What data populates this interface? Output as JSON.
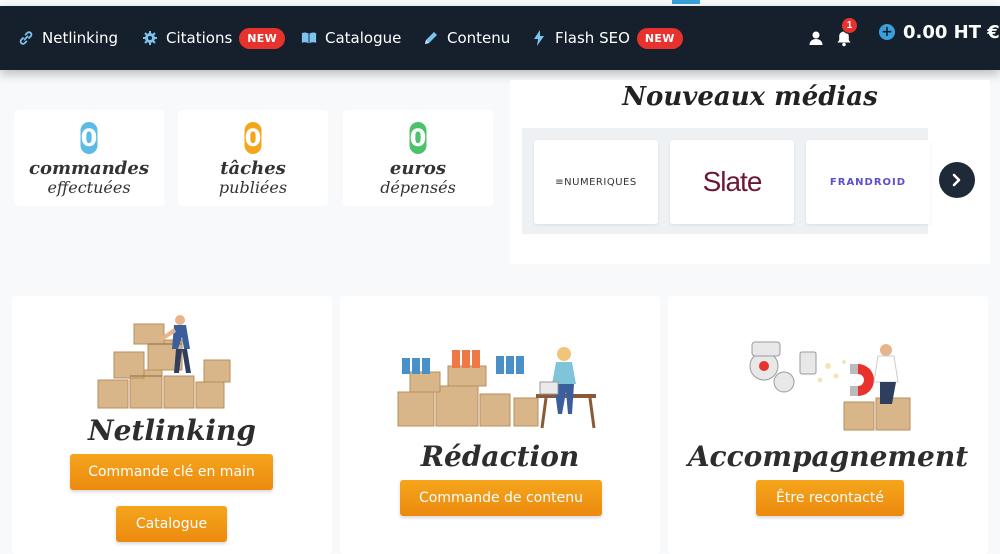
{
  "navbar": {
    "items": [
      {
        "label": "Netlinking",
        "icon": "link-icon"
      },
      {
        "label": "Citations",
        "icon": "gear-icon",
        "badge": "NEW"
      },
      {
        "label": "Catalogue",
        "icon": "book-icon"
      },
      {
        "label": "Contenu",
        "icon": "pencil-icon"
      },
      {
        "label": "Flash SEO",
        "icon": "lightning-icon",
        "badge": "NEW"
      }
    ],
    "notification_count": "1",
    "balance": "0.00 HT €"
  },
  "stats": [
    {
      "value": "0",
      "word": "commandes",
      "sub": "effectuées",
      "color": "#5bbbe6"
    },
    {
      "value": "0",
      "word": "tâches",
      "sub": "publiées",
      "color": "#f5a51c"
    },
    {
      "value": "0",
      "word": "euros",
      "sub": "dépensés",
      "color": "#4cc36a"
    }
  ],
  "media": {
    "title": "Nouveaux médias",
    "logos": [
      "≡NUMERIQUES",
      "Slate",
      "FRANDROID"
    ]
  },
  "services": [
    {
      "title": "Netlinking",
      "buttons": [
        "Commande clé en main",
        "Catalogue"
      ]
    },
    {
      "title": "Rédaction",
      "buttons": [
        "Commande de contenu"
      ]
    },
    {
      "title": "Accompagnement",
      "buttons": [
        "Être recontacté"
      ]
    }
  ],
  "colors": {
    "navbar": "#15202c",
    "accent": "#f5a51c",
    "badge": "#e8322d",
    "link": "#3aa0dc"
  }
}
